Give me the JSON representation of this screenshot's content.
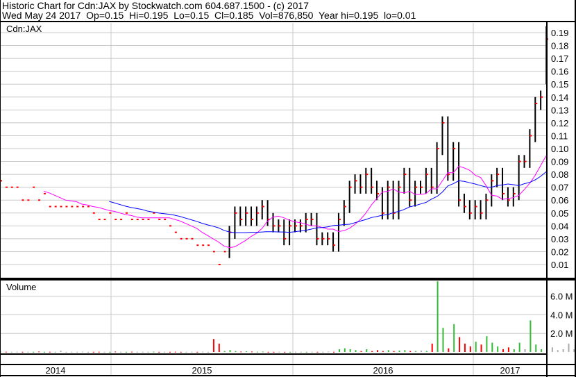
{
  "header": {
    "line1": "Historic Chart for Cdn:JAX by Stockwatch.com 604.687.1500 - (c) 2017",
    "line2": "Wed May 24 2017  Op=0.15  Hi=0.195  Lo=0.15  Cl=0.185  Vol=876,850  Year hi=0.195  lo=0.01"
  },
  "chart_data": [
    {
      "type": "line",
      "title": "Cdn:JAX",
      "ylim": [
        0,
        0.2
      ],
      "yticks": [
        "0.01",
        "0.02",
        "0.03",
        "0.04",
        "0.05",
        "0.06",
        "0.07",
        "0.08",
        "0.09",
        "0.10",
        "0.11",
        "0.12",
        "0.13",
        "0.14",
        "0.15",
        "0.16",
        "0.17",
        "0.18",
        "0.19"
      ],
      "x_labels": [
        "2014",
        "2015",
        "2016",
        "2017"
      ],
      "close": [
        0.075,
        0.07,
        0.07,
        0.07,
        0.06,
        0.06,
        0.07,
        0.06,
        0.065,
        0.055,
        0.055,
        0.055,
        0.055,
        0.055,
        0.055,
        0.055,
        0.055,
        0.05,
        0.045,
        0.045,
        0.05,
        0.045,
        0.045,
        0.05,
        0.045,
        0.045,
        0.045,
        0.045,
        0.05,
        0.045,
        0.045,
        0.04,
        0.035,
        0.03,
        0.03,
        0.03,
        0.025,
        0.025,
        0.025,
        0.02,
        0.01,
        0.02,
        0.035,
        0.05,
        0.045,
        0.05,
        0.045,
        0.05,
        0.055,
        0.045,
        0.04,
        0.04,
        0.03,
        0.04,
        0.04,
        0.04,
        0.045,
        0.045,
        0.03,
        0.03,
        0.03,
        0.025,
        0.045,
        0.055,
        0.07,
        0.075,
        0.07,
        0.08,
        0.07,
        0.065,
        0.05,
        0.07,
        0.05,
        0.07,
        0.08,
        0.06,
        0.07,
        0.07,
        0.08,
        0.07,
        0.1,
        0.12,
        0.08,
        0.1,
        0.06,
        0.055,
        0.05,
        0.055,
        0.05,
        0.06,
        0.075,
        0.08,
        0.065,
        0.06,
        0.065,
        0.09,
        0.09,
        0.11,
        0.135,
        0.14,
        0.185
      ],
      "high_last": 0.195,
      "moving_averages": [
        {
          "name": "short",
          "color": "#ff00ff",
          "period": 8
        },
        {
          "name": "long",
          "color": "#0000ff",
          "period": 20
        }
      ]
    },
    {
      "type": "bar",
      "title": "Volume",
      "yticks": [
        "2.0 M",
        "4.0 M",
        "6.0 M"
      ],
      "ylim_millions": [
        0,
        7.8
      ],
      "values_millions": [
        0.05,
        0.03,
        0.02,
        0.04,
        0.02,
        0.03,
        0.02,
        0.05,
        0.02,
        0.03,
        0.02,
        0.15,
        0.02,
        0.03,
        0.02,
        0.04,
        0.02,
        0.02,
        0.03,
        0.02,
        0.02,
        0.05,
        0.02,
        0.02,
        0.03,
        0.02,
        0.02,
        0.02,
        0.04,
        0.02,
        0.03,
        0.02,
        0.03,
        0.02,
        0.02,
        0.03,
        0.02,
        0.04,
        0.02,
        1.4,
        0.9,
        0.1,
        0.2,
        0.1,
        0.05,
        0.08,
        0.05,
        0.03,
        0.05,
        0.02,
        0.02,
        0.03,
        0.02,
        0.02,
        0.03,
        0.02,
        0.02,
        0.03,
        0.02,
        0.02,
        0.05,
        0.02,
        0.3,
        0.4,
        0.3,
        0.2,
        0.1,
        0.3,
        0.1,
        0.2,
        0.1,
        0.2,
        0.1,
        0.15,
        0.2,
        0.1,
        0.1,
        0.15,
        0.1,
        0.9,
        7.6,
        2.6,
        0.4,
        3.0,
        1.6,
        0.9,
        0.6,
        1.1,
        0.8,
        1.7,
        1.0,
        0.6,
        0.3,
        0.5,
        0.3,
        1.0,
        0.3,
        3.4,
        0.8,
        0.3,
        0.4,
        0.5,
        0.2,
        0.3,
        0.9,
        0.3,
        0.2,
        0.6,
        0.3,
        0.9
      ],
      "colors": {
        "up": "#33bb33",
        "down": "#ff0000",
        "flat": "#aaaaaa"
      }
    }
  ]
}
